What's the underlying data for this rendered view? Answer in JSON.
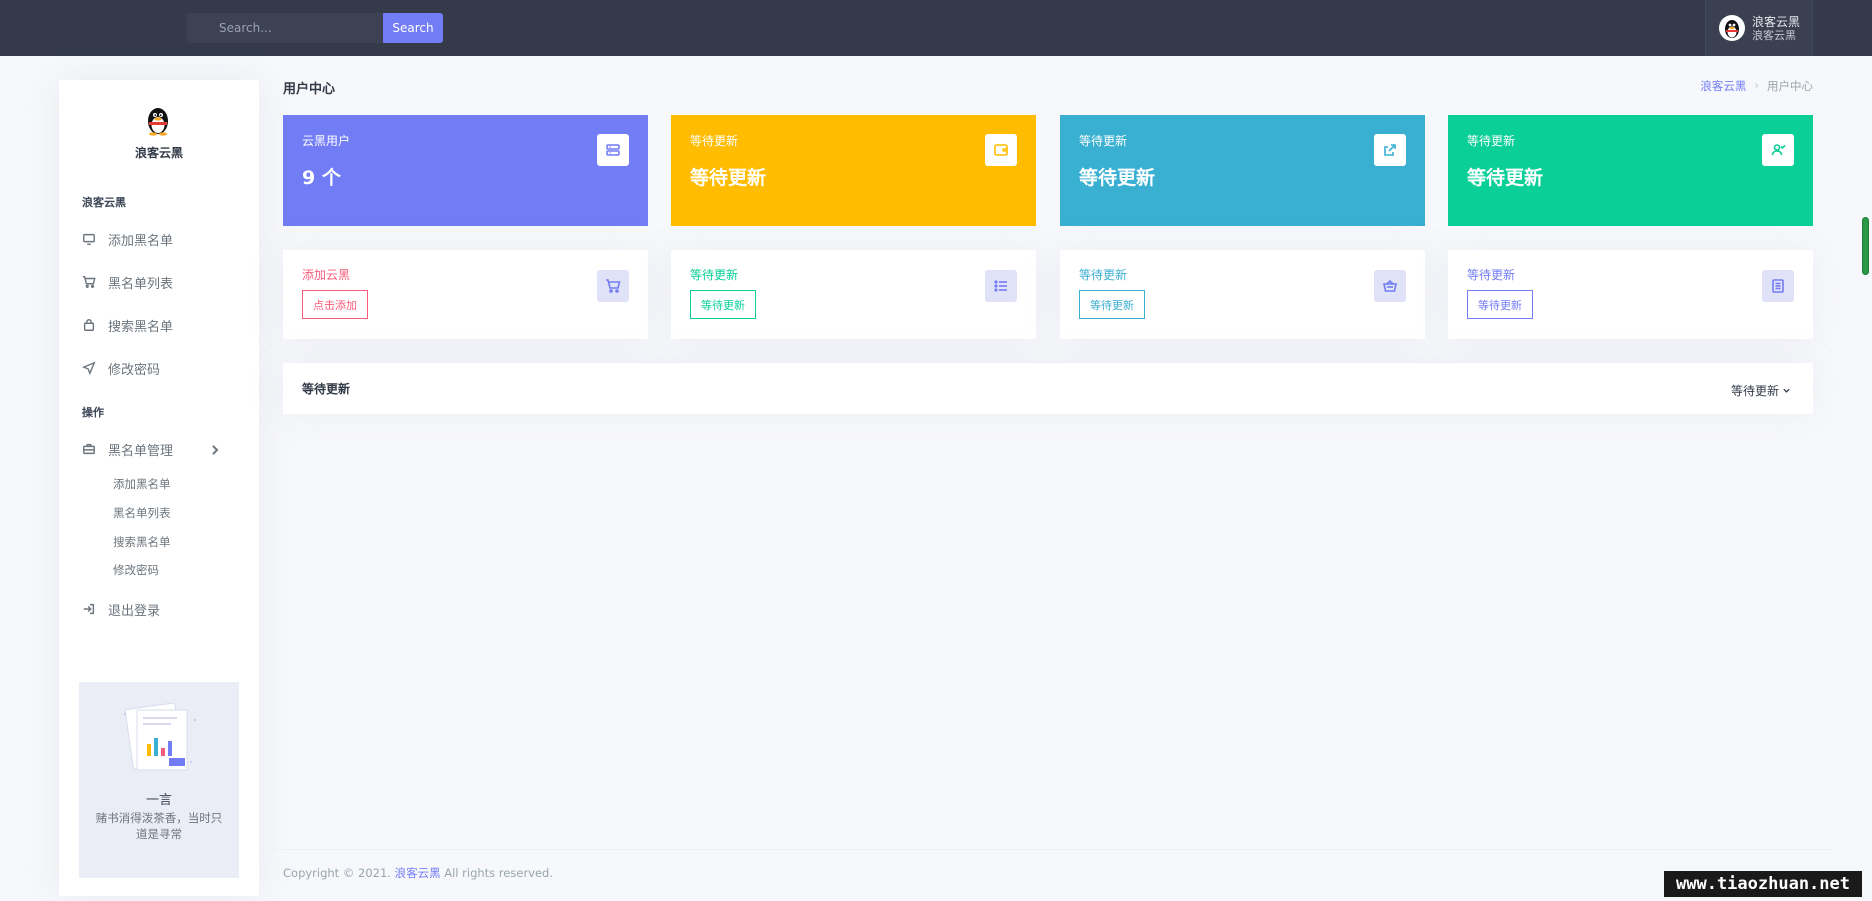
{
  "topbar": {
    "search_placeholder": "Search...",
    "search_button": "Search",
    "user_name": "浪客云黑",
    "user_role": "浪客云黑"
  },
  "sidebar": {
    "brand": "浪客云黑",
    "section1_title": "浪客云黑",
    "items": [
      {
        "label": "添加黑名单",
        "icon": "monitor-icon"
      },
      {
        "label": "黑名单列表",
        "icon": "cart-icon"
      },
      {
        "label": "搜索黑名单",
        "icon": "bag-icon"
      },
      {
        "label": "修改密码",
        "icon": "send-icon"
      }
    ],
    "section2_title": "操作",
    "manage": {
      "label": "黑名单管理",
      "icon": "briefcase-icon"
    },
    "sub_items": [
      "添加黑名单",
      "黑名单列表",
      "搜索黑名单",
      "修改密码"
    ],
    "logout": {
      "label": "退出登录",
      "icon": "logout-icon"
    },
    "help": {
      "title": "一言",
      "text": "赌书消得泼茶香，当时只道是寻常"
    }
  },
  "header": {
    "page_title": "用户中心",
    "breadcrumb_home": "浪客云黑",
    "breadcrumb_sep": "›",
    "breadcrumb_current": "用户中心"
  },
  "stats": [
    {
      "label": "云黑用户",
      "value": "9 个",
      "color": "#727cf5",
      "icon": "server-icon"
    },
    {
      "label": "等待更新",
      "value": "等待更新",
      "color": "#ffbc00",
      "icon": "wallet-icon"
    },
    {
      "label": "等待更新",
      "value": "等待更新",
      "color": "#39afd1",
      "icon": "share-icon"
    },
    {
      "label": "等待更新",
      "value": "等待更新",
      "color": "#0acf97",
      "icon": "user-icon"
    }
  ],
  "actions": [
    {
      "label": "添加云黑",
      "button": "点击添加",
      "color": "#fa5c7c",
      "icon": "cart-icon"
    },
    {
      "label": "等待更新",
      "button": "等待更新",
      "color": "#0acf97",
      "icon": "list-icon"
    },
    {
      "label": "等待更新",
      "button": "等待更新",
      "color": "#39afd1",
      "icon": "basket-icon"
    },
    {
      "label": "等待更新",
      "button": "等待更新",
      "color": "#727cf5",
      "icon": "document-icon"
    }
  ],
  "panel": {
    "title": "等待更新",
    "dropdown": "等待更新"
  },
  "footer": {
    "prefix": "Copyright © 2021.",
    "link": "浪客云黑",
    "suffix": "All rights reserved."
  },
  "watermark": "www.tiaozhuan.net"
}
